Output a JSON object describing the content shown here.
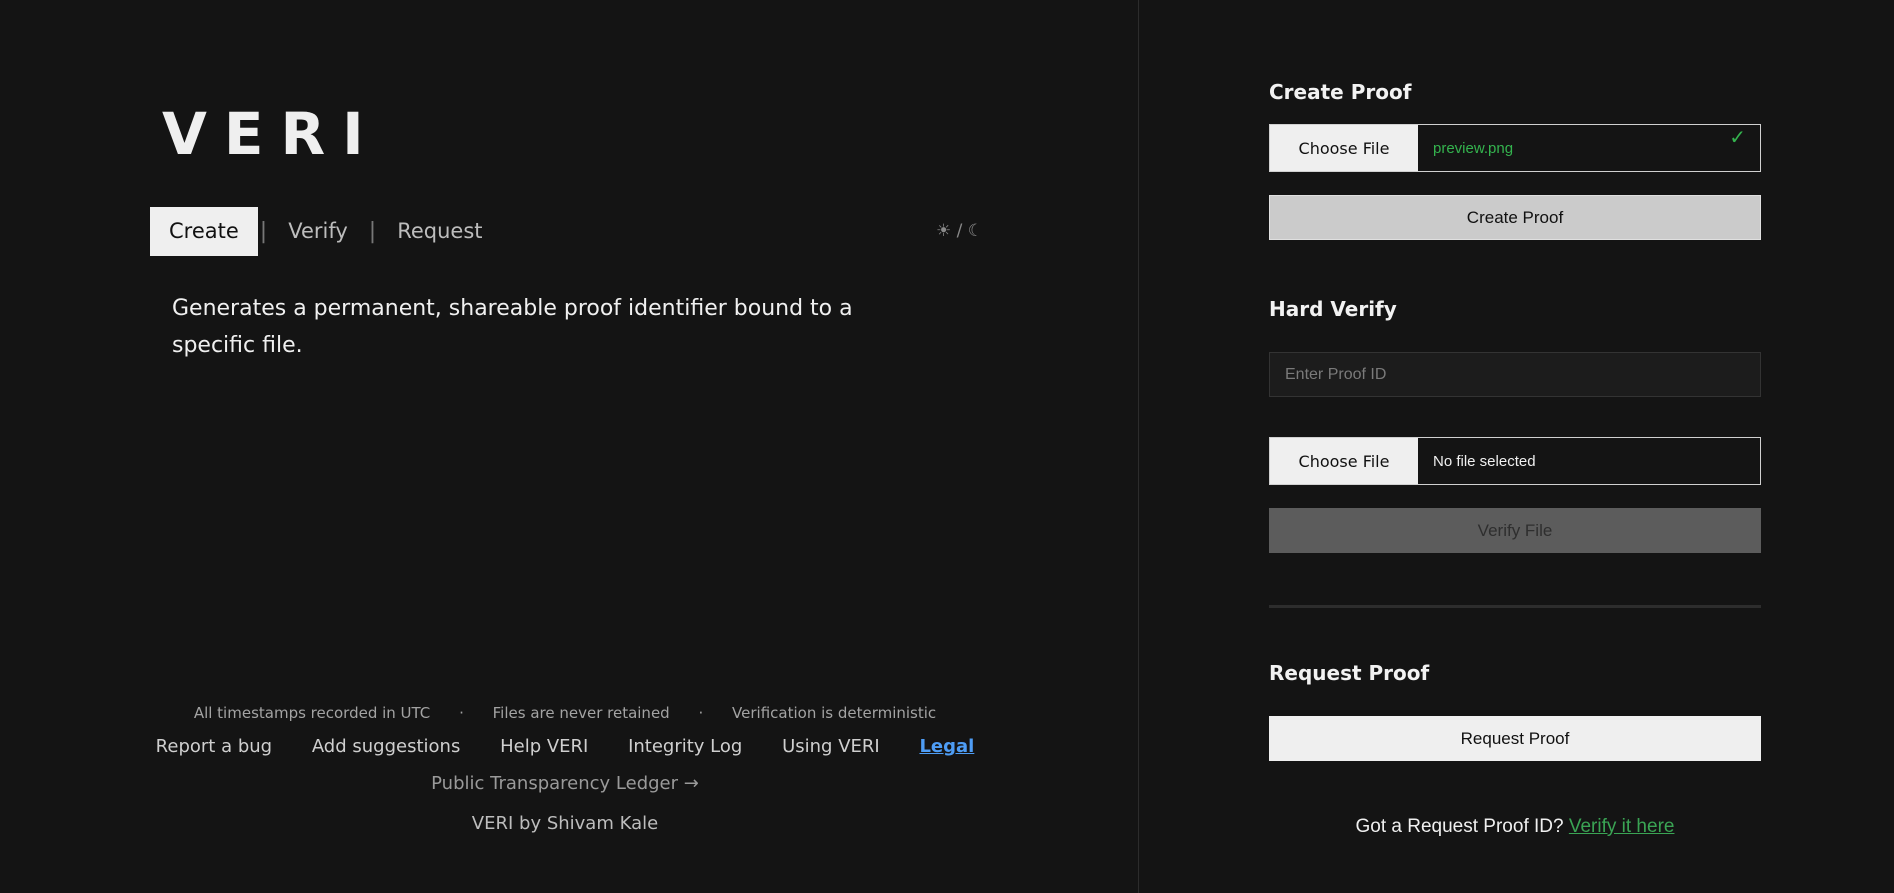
{
  "app": {
    "logo": "VERI"
  },
  "nav": {
    "tabs": [
      {
        "label": "Create",
        "active": true
      },
      {
        "label": "Verify",
        "active": false
      },
      {
        "label": "Request",
        "active": false
      }
    ],
    "separator": "|",
    "theme_toggle": "☀ / ☾"
  },
  "main": {
    "description": "Generates a permanent, shareable proof identifier bound to a specific file."
  },
  "footer": {
    "notes": [
      "All timestamps recorded in UTC",
      "Files are never retained",
      "Verification is deterministic"
    ],
    "note_separator": "·",
    "links": [
      "Report a bug",
      "Add suggestions",
      "Help VERI",
      "Integrity Log",
      "Using VERI"
    ],
    "legal": "Legal",
    "ledger": "Public Transparency Ledger →",
    "credit": "VERI by Shivam Kale"
  },
  "create_proof": {
    "title": "Create Proof",
    "choose_file_label": "Choose File",
    "file_name": "preview.png",
    "check": "✓",
    "button": "Create Proof"
  },
  "hard_verify": {
    "title": "Hard Verify",
    "placeholder": "Enter Proof ID",
    "choose_file_label": "Choose File",
    "file_name": "No file selected",
    "button": "Verify File"
  },
  "request_proof": {
    "title": "Request Proof",
    "button": "Request Proof",
    "prompt": "Got a Request Proof ID?",
    "link": "Verify it here"
  },
  "colors": {
    "accent_green": "#34b34e",
    "link_blue": "#4e9df5",
    "background": "#141414"
  }
}
